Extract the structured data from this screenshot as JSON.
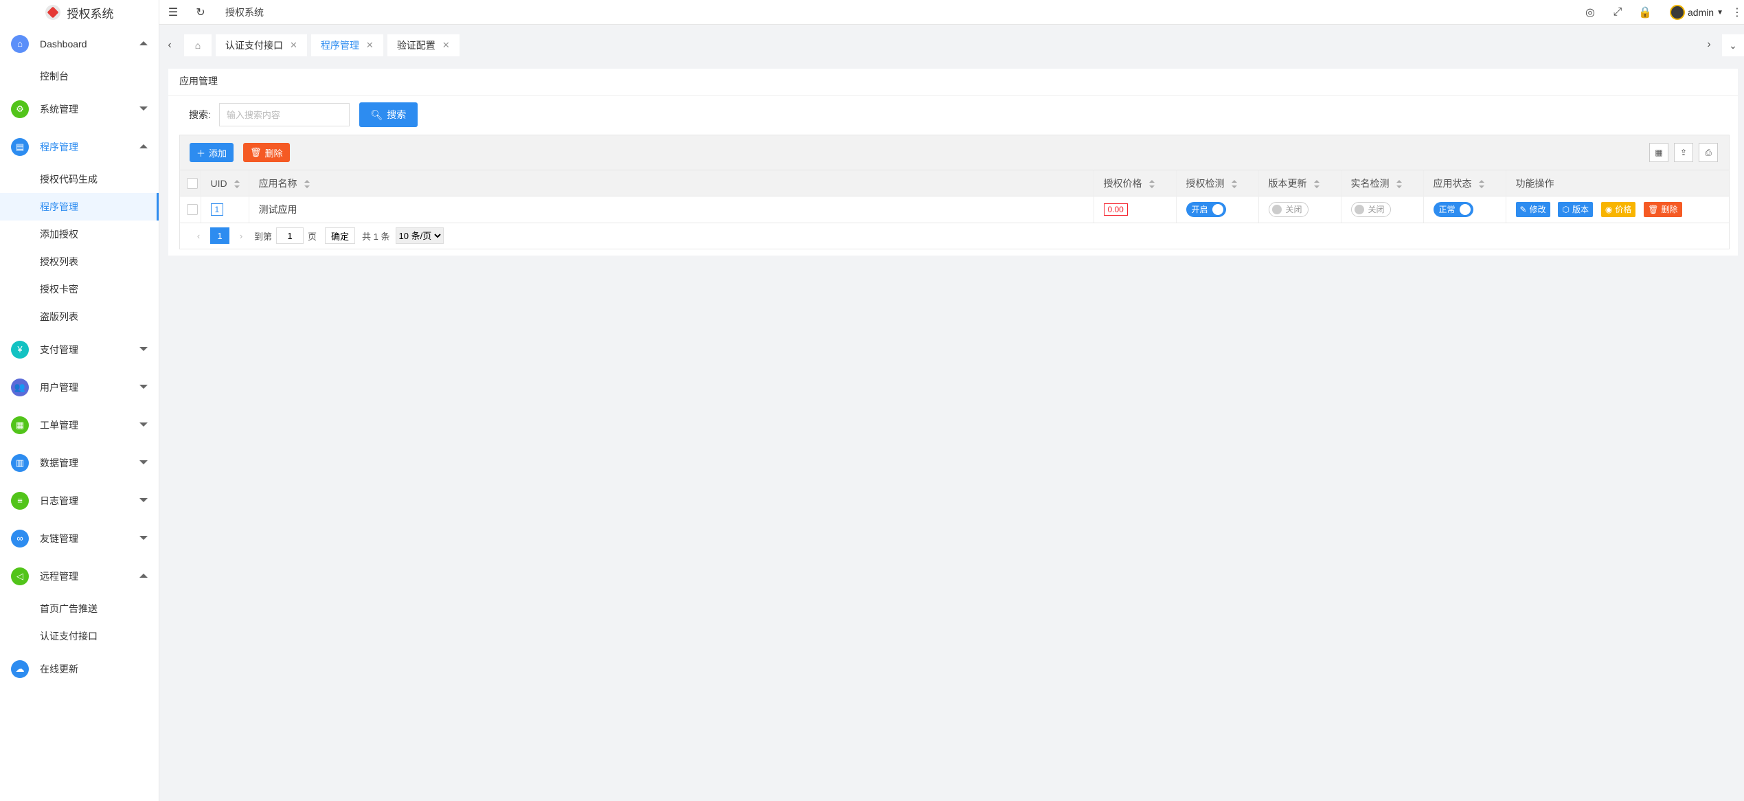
{
  "app": {
    "title": "授权系统"
  },
  "header": {
    "breadcrumb": "授权系统",
    "username": "admin"
  },
  "sidebar": {
    "groups": [
      {
        "label": "Dashboard",
        "color": "#5b8ff9",
        "expanded": true,
        "items": [
          "控制台"
        ]
      },
      {
        "label": "系统管理",
        "color": "#52c41a",
        "expanded": false,
        "items": []
      },
      {
        "label": "程序管理",
        "color": "#2d8cf0",
        "expanded": true,
        "active": true,
        "items": [
          "授权代码生成",
          "程序管理",
          "添加授权",
          "授权列表",
          "授权卡密",
          "盗版列表"
        ]
      },
      {
        "label": "支付管理",
        "color": "#13c2c2",
        "expanded": false,
        "items": []
      },
      {
        "label": "用户管理",
        "color": "#5b6bd8",
        "expanded": false,
        "items": []
      },
      {
        "label": "工单管理",
        "color": "#52c41a",
        "expanded": false,
        "items": []
      },
      {
        "label": "数据管理",
        "color": "#2d8cf0",
        "expanded": false,
        "items": []
      },
      {
        "label": "日志管理",
        "color": "#52c41a",
        "expanded": false,
        "items": []
      },
      {
        "label": "友链管理",
        "color": "#2d8cf0",
        "expanded": false,
        "items": []
      },
      {
        "label": "远程管理",
        "color": "#52c41a",
        "expanded": true,
        "items": [
          "首页广告推送",
          "认证支付接口"
        ]
      },
      {
        "label": "在线更新",
        "color": "#2d8cf0",
        "expanded": false,
        "items": []
      }
    ]
  },
  "tabs": [
    {
      "label": "认证支付接口",
      "active": false
    },
    {
      "label": "程序管理",
      "active": true
    },
    {
      "label": "验证配置",
      "active": false
    }
  ],
  "card": {
    "title": "应用管理"
  },
  "search": {
    "label": "搜索:",
    "placeholder": "输入搜索内容",
    "button": "搜索"
  },
  "toolbar": {
    "add": "添加",
    "delete": "删除"
  },
  "table": {
    "columns": [
      "UID",
      "应用名称",
      "授权价格",
      "授权检测",
      "版本更新",
      "实名检测",
      "应用状态",
      "功能操作"
    ],
    "rows": [
      {
        "uid": "1",
        "name": "测试应用",
        "price": "0.00",
        "auth_check": "开启",
        "version_update": "关闭",
        "realname_check": "关闭",
        "status": "正常",
        "actions": [
          "修改",
          "版本",
          "价格",
          "删除"
        ]
      }
    ]
  },
  "pager": {
    "current": "1",
    "goto_label": "到第",
    "page_value": "1",
    "page_unit": "页",
    "confirm": "确定",
    "total": "共 1 条",
    "page_size": "10 条/页"
  }
}
